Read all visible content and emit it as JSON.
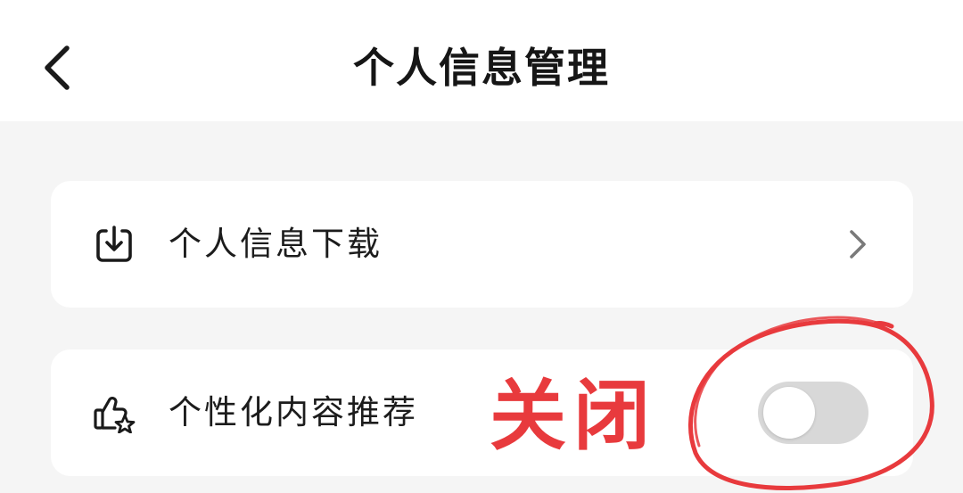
{
  "header": {
    "title": "个人信息管理",
    "back_icon": "chevron-left-icon"
  },
  "rows": [
    {
      "label": "个人信息下载",
      "icon": "download-icon",
      "trailing": "chevron-right-icon"
    },
    {
      "label": "个性化内容推荐",
      "icon": "thumbs-up-star-icon",
      "trailing": "toggle",
      "toggle_on": false
    }
  ],
  "annotation": {
    "text": "关闭",
    "color": "#e83a3d"
  },
  "colors": {
    "background": "#f5f5f5",
    "card": "#ffffff",
    "toggle_off": "#d8d8d8",
    "annotation": "#e83a3d"
  }
}
